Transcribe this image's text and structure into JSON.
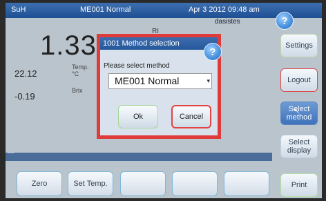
{
  "topbar": {
    "user": "SuH",
    "method": "ME001 Normal",
    "datetime": "Apr 3 2012 09:48 am",
    "operator": "dasistes",
    "help_glyph": "?"
  },
  "reading": {
    "main_value": "1.3325",
    "main_unit": "RI",
    "temp_value": "22.12",
    "temp_label_line1": "Temp.",
    "temp_label_line2": "°C",
    "brix_value": "-0.19",
    "brix_label": "Brix"
  },
  "side_buttons": {
    "settings": "Settings",
    "logout": "Logout",
    "select_method_1": "Select",
    "select_method_2": "method",
    "select_display_1": "Select",
    "select_display_2": "display",
    "print": "Print"
  },
  "status_strip": {
    "text": "---"
  },
  "bottom_buttons": {
    "zero": "Zero",
    "set_temp": "Set Temp.",
    "b3": "",
    "b4": "",
    "b5": ""
  },
  "dialog": {
    "title": "1001 Method selection",
    "help_glyph": "?",
    "prompt": "Please select method",
    "selected_method": "ME001  Normal",
    "ok_label": "Ok",
    "cancel_label": "Cancel"
  },
  "colors": {
    "accent_red": "#e03a3a",
    "title_blue": "#24579c",
    "screen_bg": "#b9c4cc"
  }
}
